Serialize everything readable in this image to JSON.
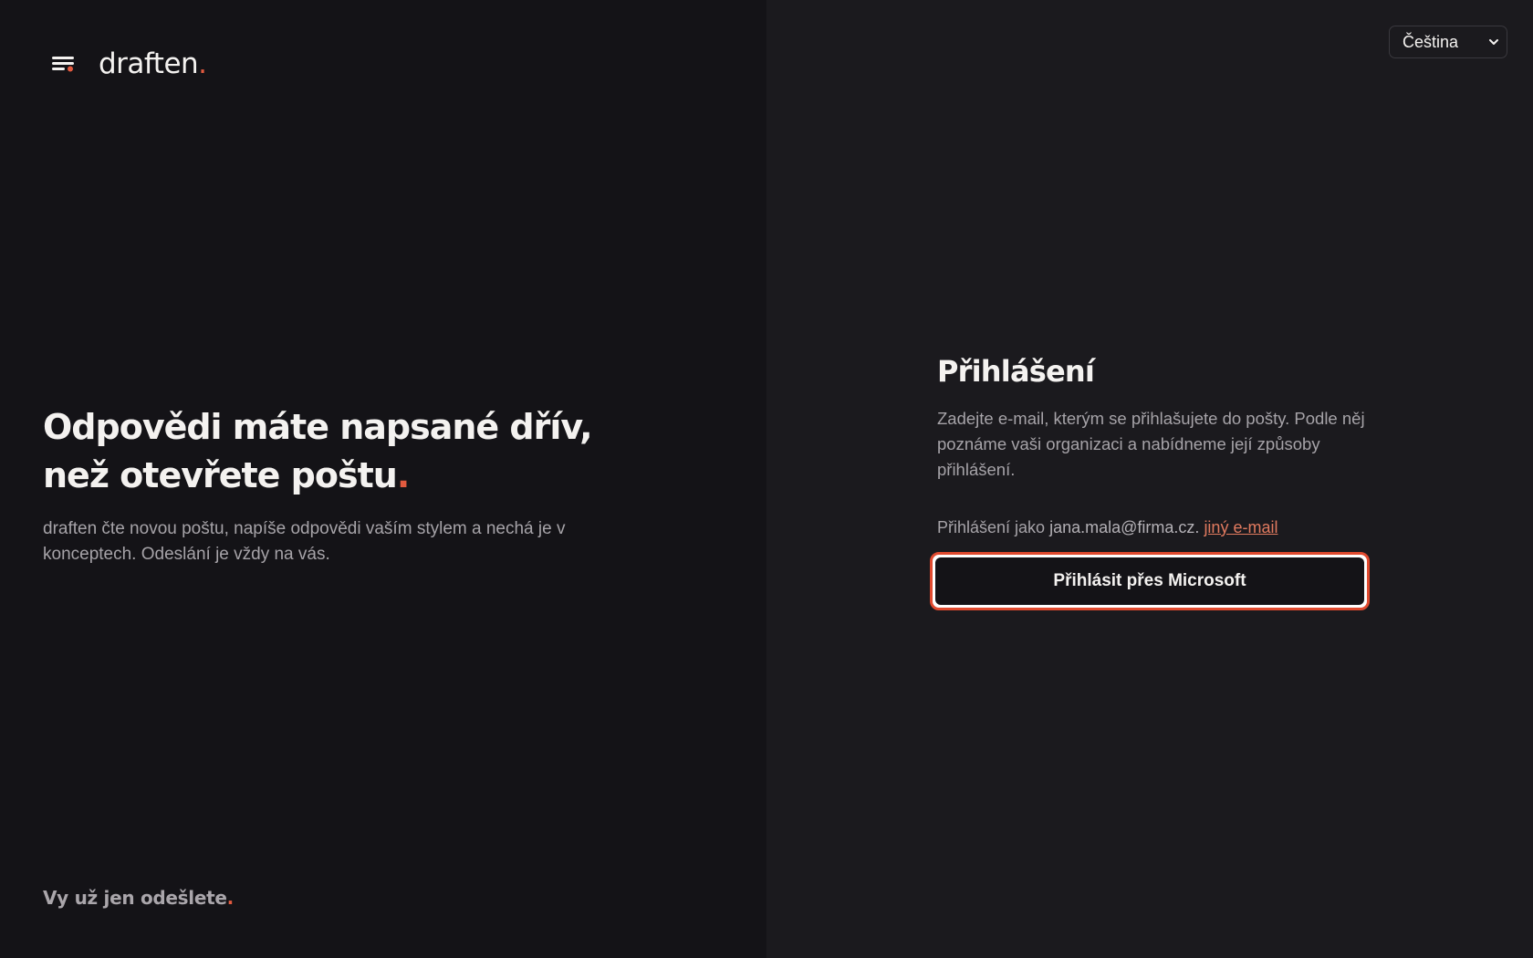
{
  "brand": {
    "name": "draften",
    "dot": "."
  },
  "hero": {
    "title_main": "Odpovědi máte napsané dřív, než otevřete poštu",
    "title_dot": ".",
    "subtitle": "draften čte novou poštu, napíše odpovědi vaším stylem a nechá je v konceptech. Odeslání je vždy na vás."
  },
  "footer": {
    "tagline": "Vy už jen odešlete",
    "dot": "."
  },
  "language": {
    "selected": "Čeština"
  },
  "login": {
    "title": "Přihlášení",
    "description": "Zadejte e-mail, kterým se přihlašujete do pošty. Podle něj poznáme vaši organizaci a nabídneme její způsoby přihlášení.",
    "signed_prefix": "Přihlášení jako",
    "email": "jana.mala@firma.cz.",
    "other_email_link": "jiný e-mail",
    "microsoft_button": "Přihlásit přes Microsoft"
  },
  "colors": {
    "accent": "#e25a3f",
    "link": "#e07a5f",
    "focus_ring": "#e04a2f"
  }
}
